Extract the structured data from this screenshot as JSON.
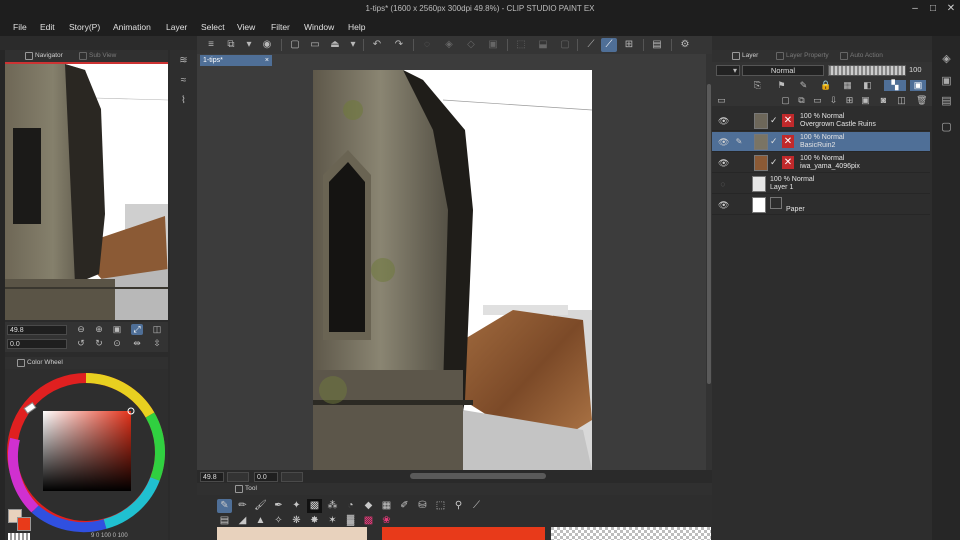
{
  "window": {
    "title": "1-tips* (1600 x 2560px 300dpi 49.8%) - CLIP STUDIO PAINT EX"
  },
  "menu": [
    "File",
    "Edit",
    "Story(P)",
    "Animation",
    "Layer",
    "Select",
    "View",
    "Filter",
    "Window",
    "Help"
  ],
  "left_tabs": {
    "navigator": "Navigator",
    "sub_view": "Sub View"
  },
  "navigator": {
    "zoom": "49.8",
    "rotation": "0.0"
  },
  "color_panel": {
    "tab": "Color Wheel",
    "readout": "9  0  100  0  100"
  },
  "document_tab": {
    "label": "1-tips*"
  },
  "canvas_status": {
    "zoom": "49.8",
    "rotation": "0.0"
  },
  "tool_panel": {
    "tab": "Tool"
  },
  "layer_panel": {
    "tabs": [
      "Layer",
      "Layer Property",
      "Auto Action"
    ],
    "blend_mode": "Normal",
    "opacity": "100",
    "layers": [
      {
        "mode": "100 % Normal",
        "name": "Overgrown Castle Ruins",
        "selected": false,
        "visible": true
      },
      {
        "mode": "100 % Normal",
        "name": "BasicRuin2",
        "selected": true,
        "visible": true
      },
      {
        "mode": "100 % Normal",
        "name": "iwa_yama_4096pix",
        "selected": false,
        "visible": true
      },
      {
        "mode": "100 % Normal",
        "name": "Layer 1",
        "selected": false,
        "visible": false
      },
      {
        "mode": "",
        "name": "Paper",
        "selected": false,
        "visible": true
      }
    ]
  },
  "colors": {
    "accent": "#4f6f97",
    "main_color": "#e8d2bd",
    "sub_color": "#e83a1a",
    "mask_red": "#c0292b"
  }
}
